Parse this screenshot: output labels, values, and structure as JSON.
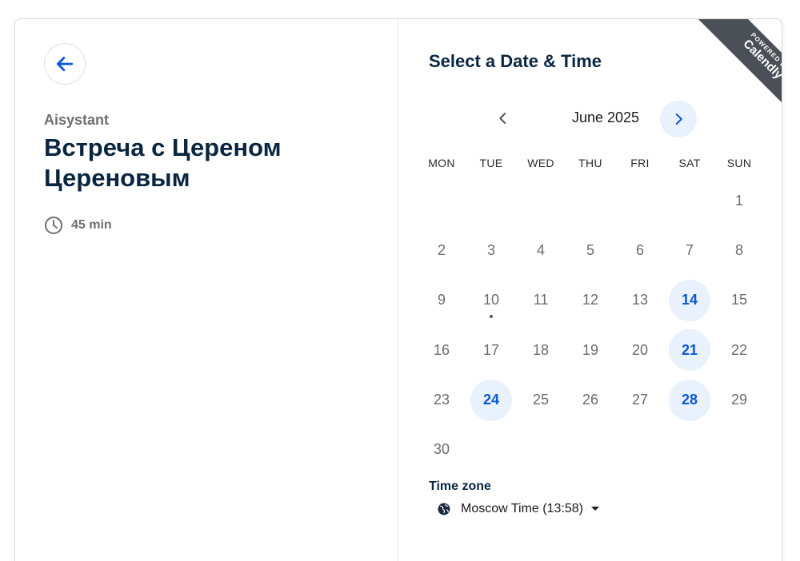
{
  "left": {
    "organizer": "Aisystant",
    "event_title": "Встреча с Цереном Цереновым",
    "duration": "45 min"
  },
  "right": {
    "heading": "Select a Date & Time",
    "month_label": "June 2025",
    "weekdays": [
      "MON",
      "TUE",
      "WED",
      "THU",
      "FRI",
      "SAT",
      "SUN"
    ],
    "weeks": [
      [
        "",
        "",
        "",
        "",
        "",
        "",
        "1"
      ],
      [
        "2",
        "3",
        "4",
        "5",
        "6",
        "7",
        "8"
      ],
      [
        "9",
        "10",
        "11",
        "12",
        "13",
        "14",
        "15"
      ],
      [
        "16",
        "17",
        "18",
        "19",
        "20",
        "21",
        "22"
      ],
      [
        "23",
        "24",
        "25",
        "26",
        "27",
        "28",
        "29"
      ],
      [
        "30",
        "",
        "",
        "",
        "",
        "",
        ""
      ]
    ],
    "available_days": [
      "14",
      "21",
      "24",
      "28"
    ],
    "today_marker_day": "10",
    "timezone_label": "Time zone",
    "timezone_value": "Moscow Time (13:58)"
  },
  "ribbon": {
    "small_text": "POWERED BY",
    "brand": "Calendly"
  },
  "colors": {
    "accent": "#0a58d6",
    "available_bg": "#e9f1fd",
    "title": "#0a2540",
    "ribbon": "#4b5057"
  },
  "icons": {
    "back": "arrow-left-icon",
    "clock": "clock-icon",
    "prev": "chevron-left-icon",
    "next": "chevron-right-icon",
    "globe": "globe-icon",
    "caret": "caret-down-icon"
  }
}
